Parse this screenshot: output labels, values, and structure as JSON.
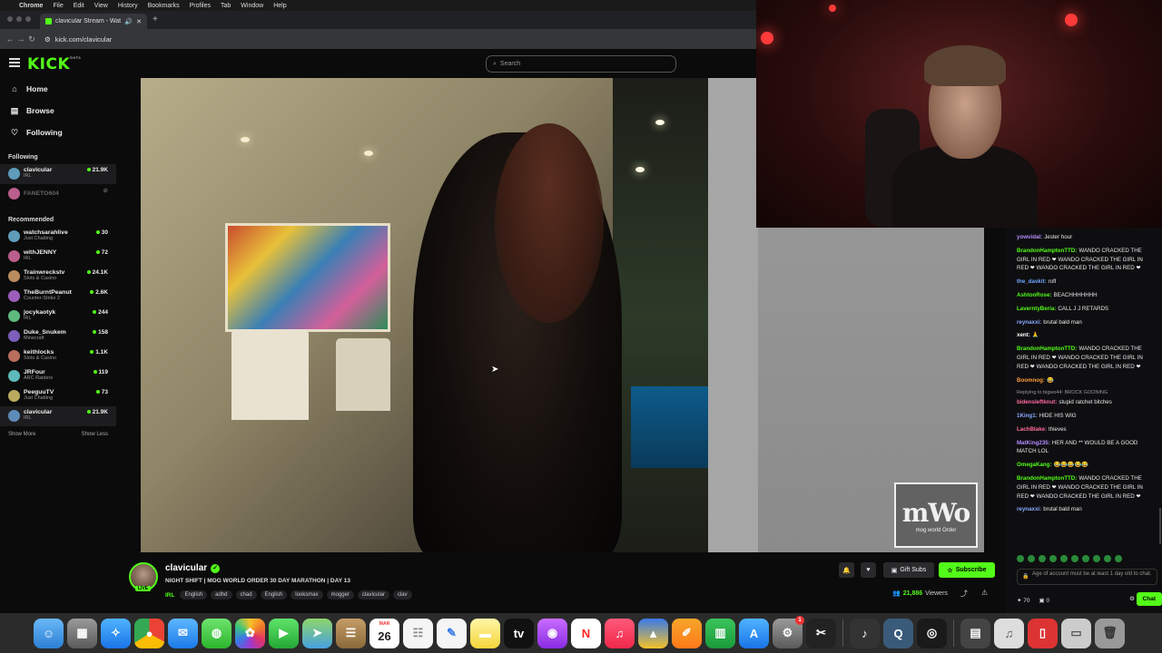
{
  "menubar": {
    "items": [
      "Chrome",
      "File",
      "Edit",
      "View",
      "History",
      "Bookmarks",
      "Profiles",
      "Tab",
      "Window",
      "Help"
    ]
  },
  "browser": {
    "tab_title": "clavicular Stream - Watch",
    "url": "kick.com/clavicular"
  },
  "header": {
    "logo": "KICK",
    "logo_suffix": "beta",
    "search_placeholder": "Search"
  },
  "sidebar": {
    "nav": [
      {
        "label": "Home",
        "icon": "home-icon"
      },
      {
        "label": "Browse",
        "icon": "browse-icon"
      },
      {
        "label": "Following",
        "icon": "heart-icon"
      }
    ],
    "following_title": "Following",
    "following": [
      {
        "name": "clavicular",
        "category": "IRL",
        "viewers": "21.9K",
        "live": true
      },
      {
        "name": "FANETO604",
        "category": "",
        "viewers": "",
        "live": false
      }
    ],
    "recommended_title": "Recommended",
    "recommended": [
      {
        "name": "watchsarahlive",
        "category": "Just Chatting",
        "viewers": "30"
      },
      {
        "name": "withJENNY",
        "category": "IRL",
        "viewers": "72"
      },
      {
        "name": "Trainwreckstv",
        "category": "Slots & Casino",
        "viewers": "24.1K"
      },
      {
        "name": "TheBurntPeanut",
        "category": "Counter-Strike 2",
        "viewers": "2.6K"
      },
      {
        "name": "jocykaotyk",
        "category": "IRL",
        "viewers": "244"
      },
      {
        "name": "Duke_Snukem",
        "category": "Minecraft",
        "viewers": "158"
      },
      {
        "name": "keithlocks",
        "category": "Slots & Casino",
        "viewers": "1.1K"
      },
      {
        "name": "JRFour",
        "category": "ARC Raiders",
        "viewers": "119"
      },
      {
        "name": "PeeguuTV",
        "category": "Just Chatting",
        "viewers": "73"
      },
      {
        "name": "clavicular",
        "category": "IRL",
        "viewers": "21.9K"
      }
    ],
    "show_more": "Show More",
    "show_less": "Show Less"
  },
  "overlay": {
    "mwo_logo": "mWo",
    "mwo_text": "mog world Order"
  },
  "stream": {
    "channel": "clavicular",
    "live_badge": "LIVE",
    "title": "NIGHT SHIFT | MOG WORLD ORDER 30 DAY MARATHON | DAY 13",
    "category": "IRL",
    "tags": [
      "English",
      "adhd",
      "chad",
      "English",
      "looksmax",
      "mogger",
      "clavicular",
      "clav"
    ],
    "gift_subs": "Gift Subs",
    "subscribe": "Subscribe",
    "viewers_count": "21,886",
    "viewers_label": "Viewers"
  },
  "chat": {
    "messages": [
      {
        "user": "yowvidal:",
        "text": "Jester hour",
        "color": "#b48cff"
      },
      {
        "user": "BrandonHamptonTTD:",
        "text": "WANDO CRACKED THE GIRL IN RED ❤ WANDO CRACKED THE GIRL IN RED ❤ WANDO CRACKED THE GIRL IN RED ❤",
        "color": "#53fc18"
      },
      {
        "user": "the_davkit:",
        "text": "rofl",
        "color": "#6ea8ff"
      },
      {
        "user": "AshtonRose:",
        "text": "BEACHHHHHHH",
        "color": "#53fc18"
      },
      {
        "user": "LaverntyBeria:",
        "text": "CALL J J RETARDS",
        "color": "#53fc18"
      },
      {
        "user": "reynaxxi:",
        "text": "brutal bald man",
        "color": "#8aa8ff"
      },
      {
        "user": "xent:",
        "text": "🙏",
        "color": "#ffffff"
      },
      {
        "user": "BrandonHamptonTTD:",
        "text": "WANDO CRACKED THE GIRL IN RED ❤ WANDO CRACKED THE GIRL IN RED ❤ WANDO CRACKED THE GIRL IN RED ❤",
        "color": "#53fc18"
      },
      {
        "user": "Boomnog:",
        "text": "😂",
        "color": "#ff9a3c"
      },
      {
        "reply": "Replying to bigwo44: BROCK GOONING",
        "user": "bidensleftknut:",
        "text": "stupid ratchet bitches",
        "color": "#ff6b9d"
      },
      {
        "user": "1King1:",
        "text": "HIDE HIS WIG",
        "color": "#8aa8ff"
      },
      {
        "user": "LachBlake:",
        "text": "thieves",
        "color": "#ff6b9d"
      },
      {
        "user": "MatKing235:",
        "text": "HER AND ** WOULD BE A GOOD MATCH LOL",
        "color": "#b48cff"
      },
      {
        "user": "OmegaKang:",
        "text": "😂😂😂😂😂",
        "color": "#53fc18"
      },
      {
        "user": "BrandonHamptonTTD:",
        "text": "WANDO CRACKED THE GIRL IN RED ❤ WANDO CRACKED THE GIRL IN RED ❤ WANDO CRACKED THE GIRL IN RED ❤",
        "color": "#53fc18"
      },
      {
        "user": "reynaxxi:",
        "text": "brutal bald man",
        "color": "#8aa8ff"
      }
    ],
    "input_notice": "Age of account must be at least 1 day old to chat.",
    "points": "70",
    "gift_count": "0",
    "chat_button": "Chat"
  },
  "dock": {
    "calendar_month": "MAR",
    "calendar_day": "26",
    "settings_badge": "1"
  },
  "colors": {
    "accent": "#53fc18",
    "background": "#0b0b0b"
  }
}
